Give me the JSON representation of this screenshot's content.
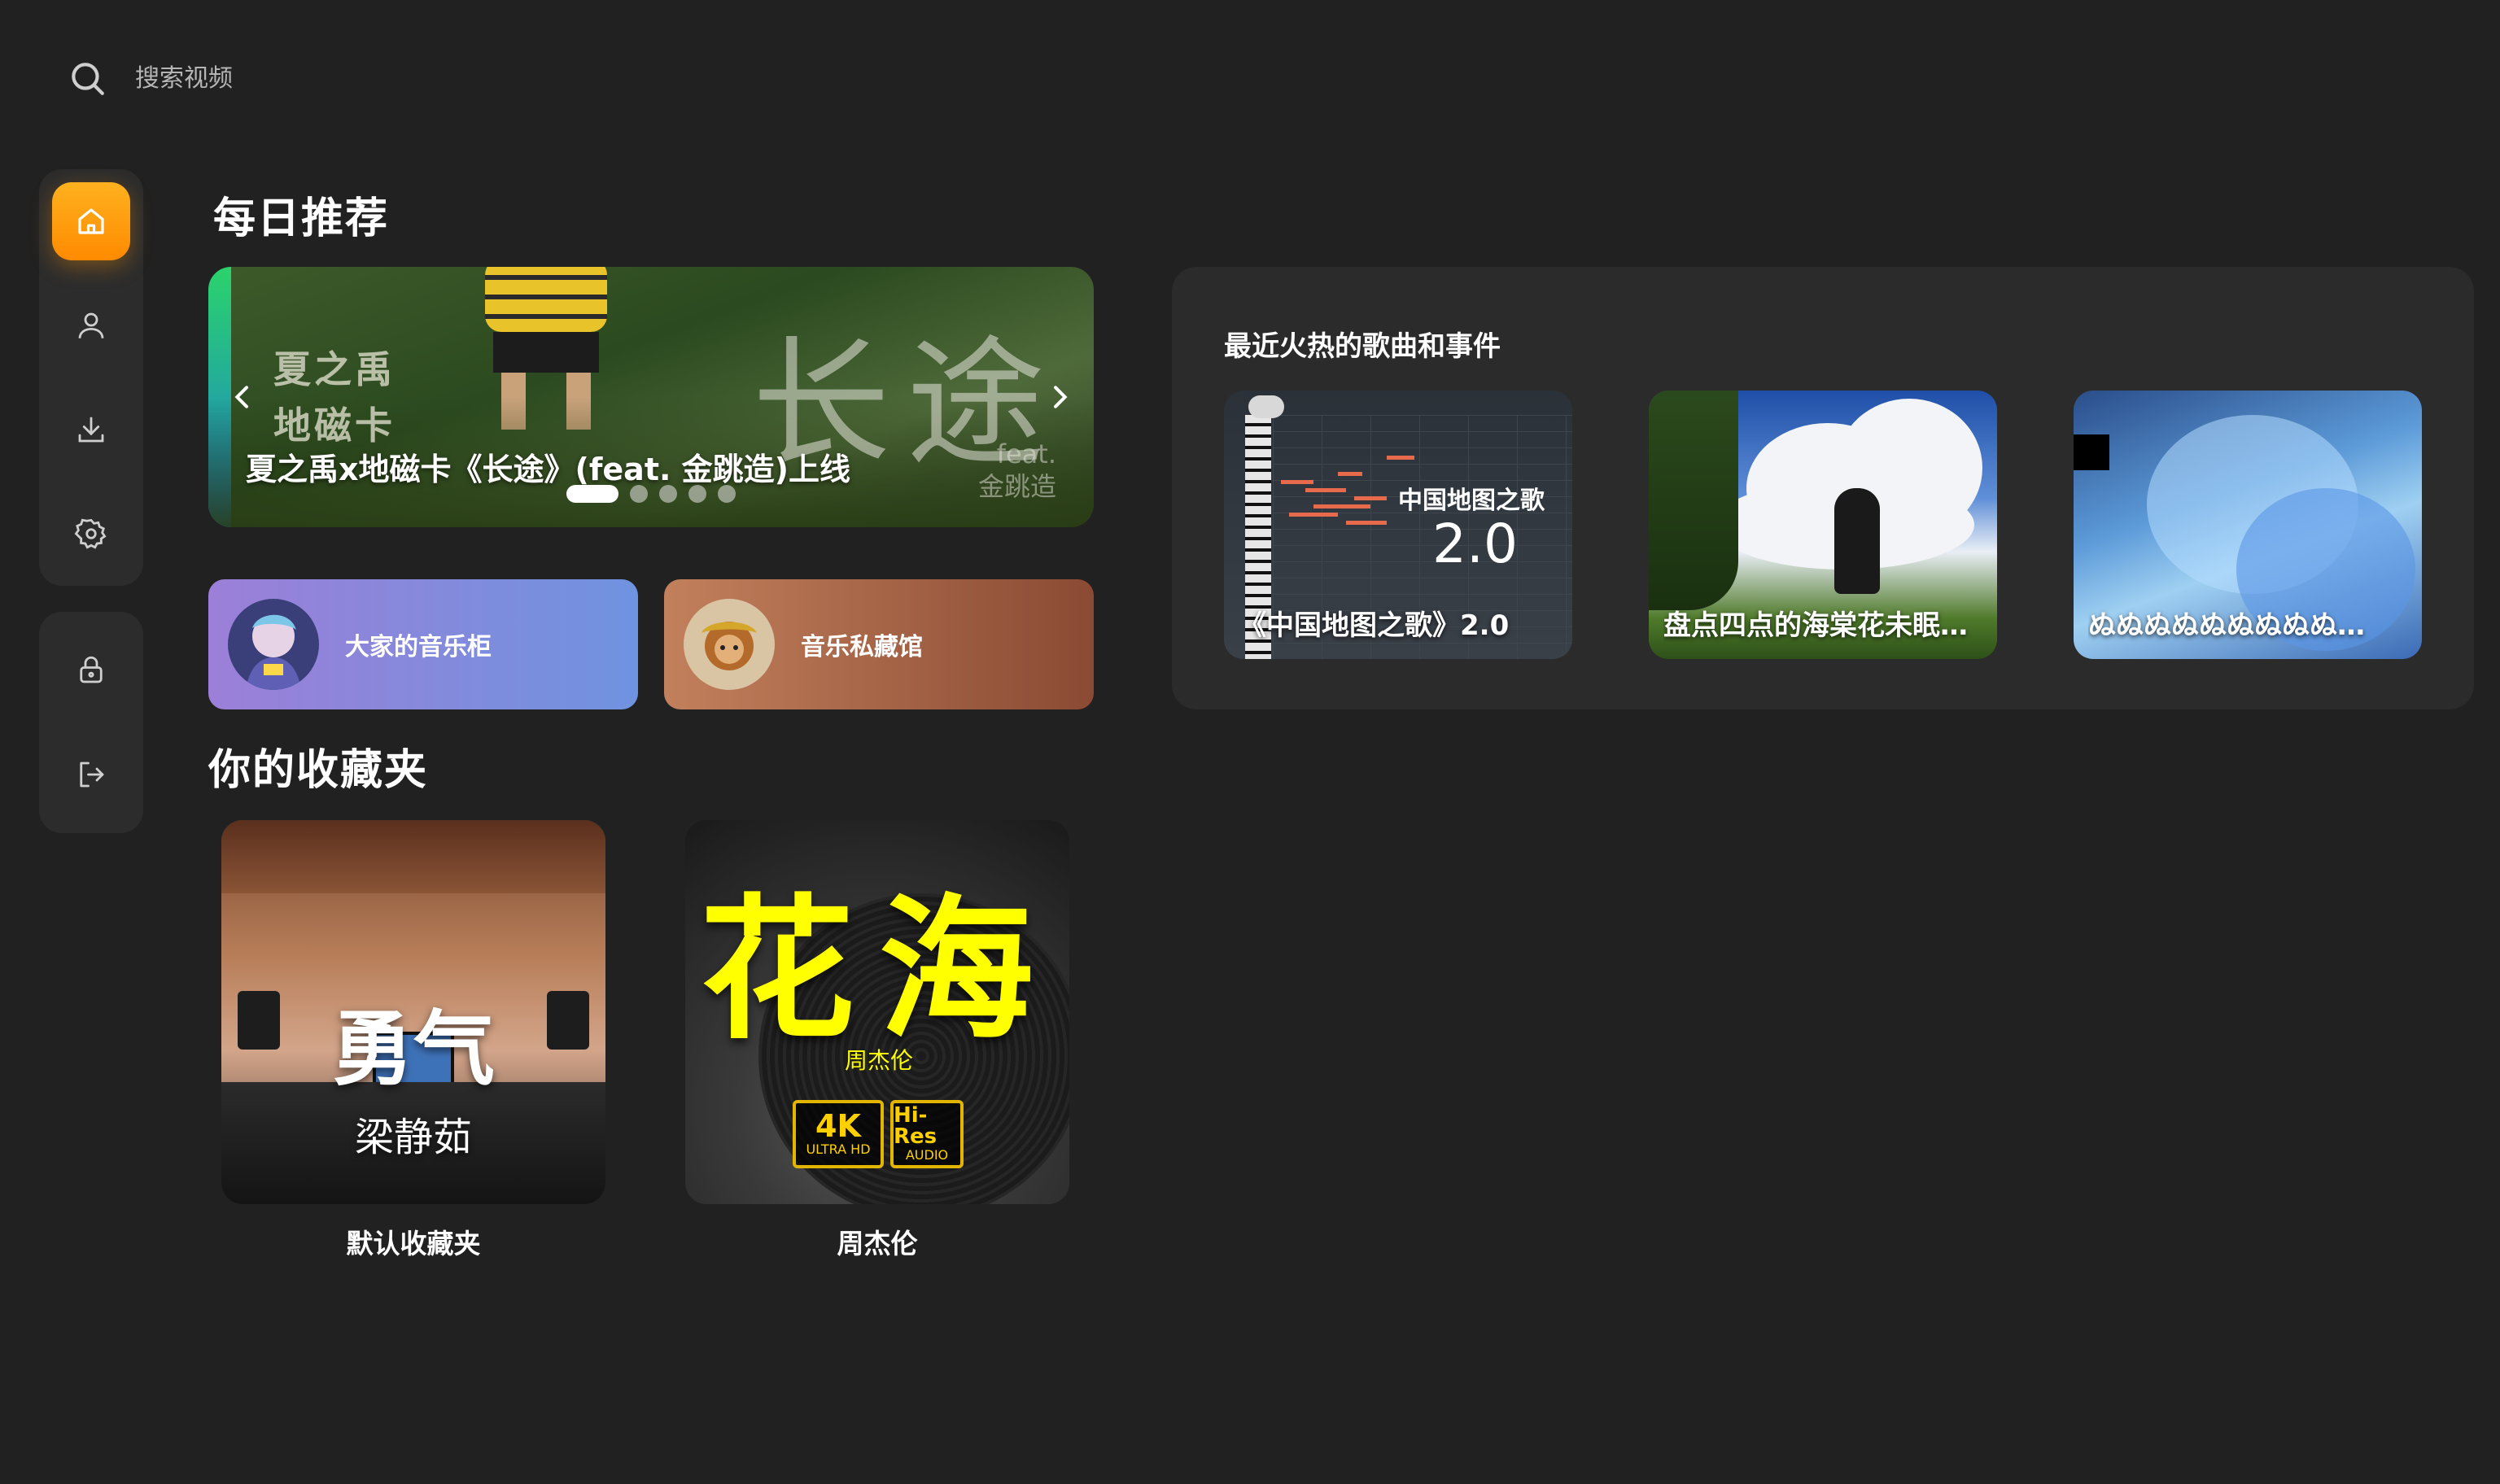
{
  "search": {
    "placeholder": "搜索视频"
  },
  "sidebar": {
    "top": [
      {
        "name": "home",
        "icon": "home-icon",
        "active": true
      },
      {
        "name": "profile",
        "icon": "user-icon",
        "active": false
      },
      {
        "name": "download",
        "icon": "download-icon",
        "active": false
      },
      {
        "name": "settings",
        "icon": "gear-icon",
        "active": false
      }
    ],
    "bottom": [
      {
        "name": "lock",
        "icon": "lock-icon"
      },
      {
        "name": "logout",
        "icon": "logout-icon"
      }
    ],
    "accent": "#ff9a0a"
  },
  "daily": {
    "title": "每日推荐",
    "banner": {
      "caption": "夏之禹x地磁卡《长途》(feat. 金跳造)上线",
      "artist_line1": "夏之禹",
      "artist_line2": "地磁卡",
      "big_title": "长途",
      "feat_line1": "feat.",
      "feat_line2": "金跳造",
      "slides": 5,
      "active_slide": 1
    },
    "pills": [
      {
        "label": "大家的音乐柜"
      },
      {
        "label": "音乐私藏馆"
      }
    ]
  },
  "favorites": {
    "title": "你的收藏夹",
    "items": [
      {
        "name": "默认收藏夹",
        "cover_title": "勇气",
        "cover_subtitle": "梁静茹"
      },
      {
        "name": "周杰伦",
        "cover_title": "花海",
        "cover_subtitle": "周杰伦",
        "badge1_big": "4K",
        "badge1_small": "ULTRA HD",
        "badge2_big": "Hi-Res",
        "badge2_small": "AUDIO"
      }
    ]
  },
  "hot": {
    "title": "最近火热的歌曲和事件",
    "items": [
      {
        "caption": "《中国地图之歌》2.0",
        "cover_label": "中国地图之歌",
        "cover_version": "2.0"
      },
      {
        "caption": "盘点四点的海棠花未眠…"
      },
      {
        "caption": "ぬぬぬぬぬぬぬぬぬ…"
      }
    ]
  }
}
